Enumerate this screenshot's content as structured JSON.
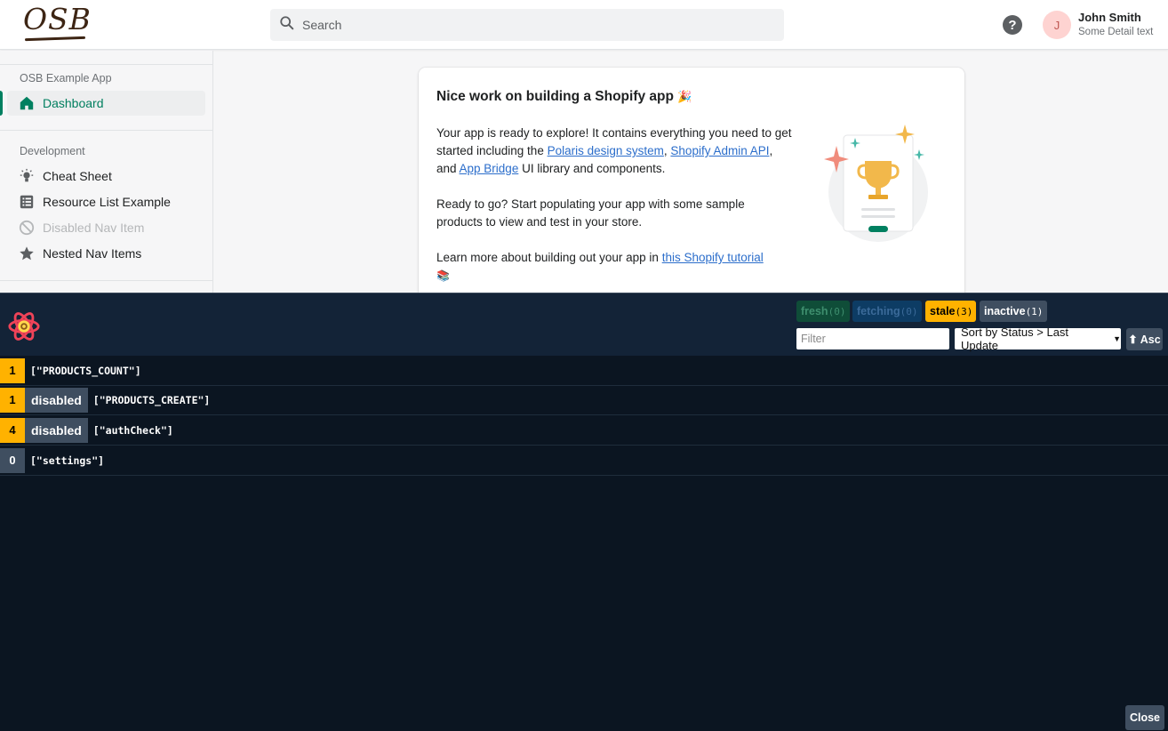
{
  "header": {
    "logo_text": "OSB",
    "search_placeholder": "Search",
    "help_symbol": "?",
    "user": {
      "initial": "J",
      "name": "John Smith",
      "detail": "Some Detail text"
    }
  },
  "sidebar": {
    "app_section": {
      "title": "OSB Example App",
      "items": [
        {
          "label": "Dashboard",
          "icon": "home-icon",
          "active": true
        }
      ]
    },
    "dev_section": {
      "title": "Development",
      "items": [
        {
          "label": "Cheat Sheet",
          "icon": "lightbulb-icon"
        },
        {
          "label": "Resource List Example",
          "icon": "list-icon"
        },
        {
          "label": "Disabled Nav Item",
          "icon": "disabled-circle-icon",
          "disabled": true
        },
        {
          "label": "Nested Nav Items",
          "icon": "star-icon"
        }
      ]
    }
  },
  "card": {
    "title": "Nice work on building a Shopify app",
    "title_emoji": "🎉",
    "p1_before": "Your app is ready to explore! It contains everything you need to get started including the ",
    "link_polaris": "Polaris design system",
    "p1_sep1": ", ",
    "link_admin_api": "Shopify Admin API",
    "p1_sep2": ", and ",
    "link_app_bridge": "App Bridge",
    "p1_after": " UI library and components.",
    "p2": "Ready to go? Start populating your app with some sample products to view and test in your store.",
    "p3_before": "Learn more about building out your app in ",
    "link_tutorial": "this Shopify tutorial",
    "p3_emoji": "📚"
  },
  "devtools": {
    "filters": [
      {
        "label": "fresh",
        "count": "(0)"
      },
      {
        "label": "fetching",
        "count": "(0)"
      },
      {
        "label": "stale",
        "count": "(3)"
      },
      {
        "label": "inactive",
        "count": "(1)"
      }
    ],
    "filter_placeholder": "Filter",
    "sort_label": "Sort by Status > Last Update",
    "asc_label": "⬆ Asc",
    "queries": [
      {
        "count": "1",
        "status": "stale",
        "disabled": "",
        "key": "[\"PRODUCTS_COUNT\"]"
      },
      {
        "count": "1",
        "status": "stale",
        "disabled": "disabled",
        "key": "[\"PRODUCTS_CREATE\"]"
      },
      {
        "count": "4",
        "status": "stale",
        "disabled": "disabled",
        "key": "[\"authCheck\"]"
      },
      {
        "count": "0",
        "status": "inactive",
        "disabled": "",
        "key": "[\"settings\"]"
      }
    ],
    "close_label": "Close"
  },
  "colors": {
    "brand_green": "#008060",
    "link_blue": "#2c6ecb",
    "stale_yellow": "#ffb200",
    "devtools_bg": "#0b1521"
  }
}
